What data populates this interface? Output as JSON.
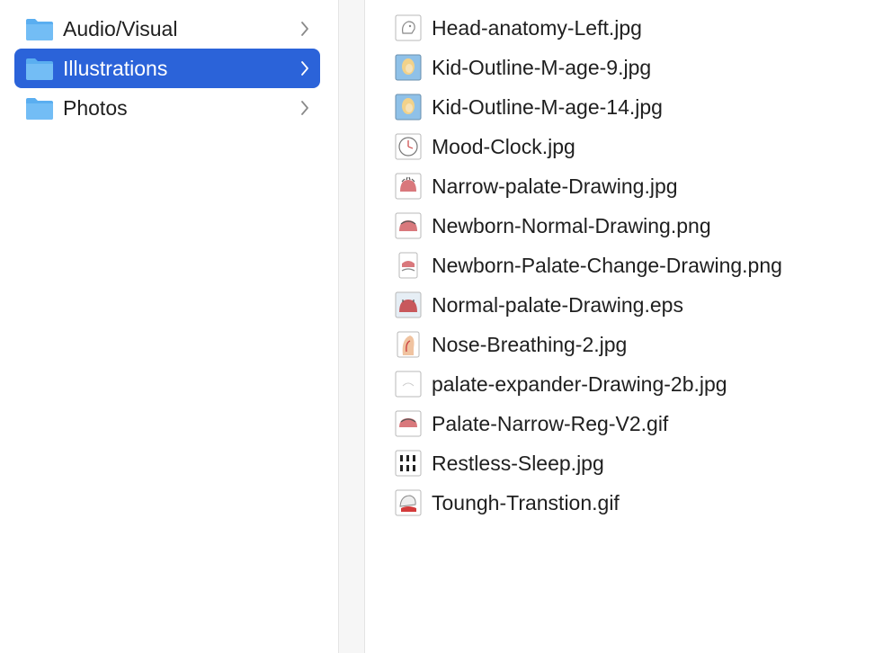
{
  "sidebar": {
    "folders": [
      {
        "label": "Audio/Visual",
        "icon": "folder-icon"
      },
      {
        "label": "Illustrations",
        "icon": "folder-icon",
        "selected": true
      },
      {
        "label": "Photos",
        "icon": "folder-icon"
      }
    ]
  },
  "files": [
    {
      "label": "Head-anatomy-Left.jpg",
      "icon": "image-thumbnail-icon"
    },
    {
      "label": "Kid-Outline-M-age-9.jpg",
      "icon": "image-thumbnail-icon"
    },
    {
      "label": "Kid-Outline-M-age-14.jpg",
      "icon": "image-thumbnail-icon"
    },
    {
      "label": "Mood-Clock.jpg",
      "icon": "image-thumbnail-icon"
    },
    {
      "label": "Narrow-palate-Drawing.jpg",
      "icon": "image-thumbnail-icon"
    },
    {
      "label": "Newborn-Normal-Drawing.png",
      "icon": "image-thumbnail-icon"
    },
    {
      "label": "Newborn-Palate-Change-Drawing.png",
      "icon": "image-thumbnail-icon"
    },
    {
      "label": "Normal-palate-Drawing.eps",
      "icon": "image-thumbnail-icon"
    },
    {
      "label": "Nose-Breathing-2.jpg",
      "icon": "image-thumbnail-icon"
    },
    {
      "label": "palate-expander-Drawing-2b.jpg",
      "icon": "image-thumbnail-icon"
    },
    {
      "label": "Palate-Narrow-Reg-V2.gif",
      "icon": "image-thumbnail-icon"
    },
    {
      "label": "Restless-Sleep.jpg",
      "icon": "image-thumbnail-icon"
    },
    {
      "label": "Toungh-Transtion.gif",
      "icon": "image-thumbnail-icon"
    }
  ],
  "colors": {
    "selection": "#2b63d9",
    "folder": "#5aaef0",
    "divider": "#f6f6f6"
  }
}
